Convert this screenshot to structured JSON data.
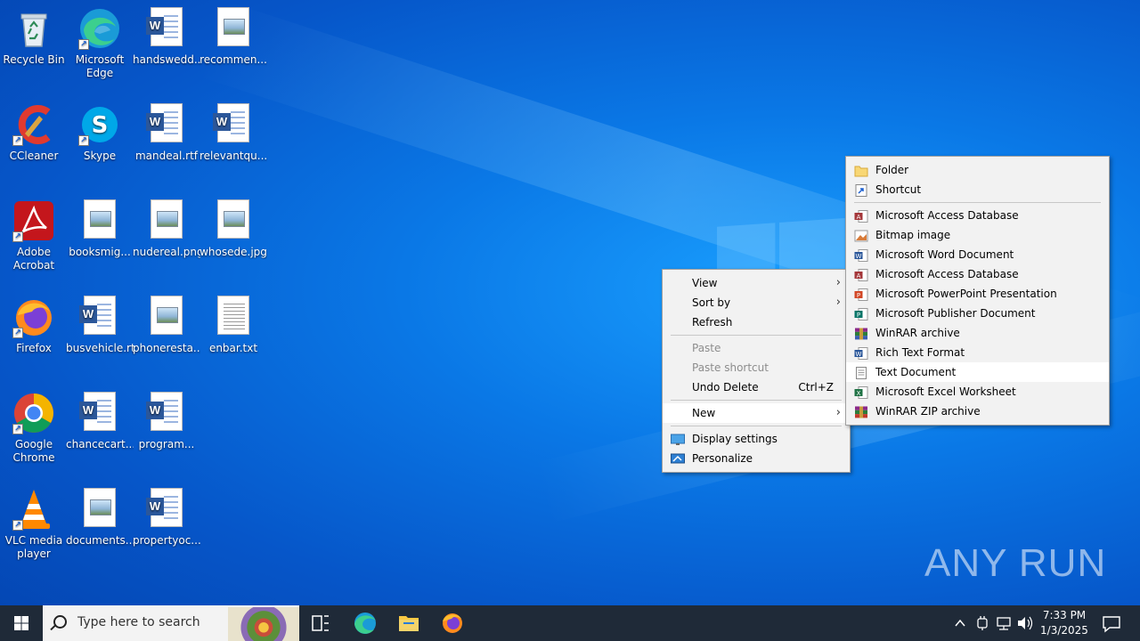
{
  "desktop": {
    "icons": [
      {
        "label": "Recycle Bin"
      },
      {
        "label": "Microsoft Edge"
      },
      {
        "label": "handswedd..."
      },
      {
        "label": "recommen..."
      },
      {
        "label": "CCleaner"
      },
      {
        "label": "Skype"
      },
      {
        "label": "mandeal.rtf"
      },
      {
        "label": "relevantqu..."
      },
      {
        "label": "Adobe Acrobat"
      },
      {
        "label": "booksmig..."
      },
      {
        "label": "nudereal.png"
      },
      {
        "label": "whosede.jpg"
      },
      {
        "label": "Firefox"
      },
      {
        "label": "busvehicle.rtf"
      },
      {
        "label": "phoneresta..."
      },
      {
        "label": "enbar.txt"
      },
      {
        "label": "Google Chrome"
      },
      {
        "label": "chancecart..."
      },
      {
        "label": "program..."
      },
      {
        "label": "VLC media player"
      },
      {
        "label": "documents..."
      },
      {
        "label": "propertyoc..."
      }
    ]
  },
  "context_menu": {
    "view": "View",
    "sort_by": "Sort by",
    "refresh": "Refresh",
    "paste": "Paste",
    "paste_shortcut": "Paste shortcut",
    "undo_delete": "Undo Delete",
    "undo_delete_accel": "Ctrl+Z",
    "new": "New",
    "display_settings": "Display settings",
    "personalize": "Personalize"
  },
  "new_submenu": {
    "items": [
      {
        "label": "Folder",
        "icon": "folder-icon"
      },
      {
        "label": "Shortcut",
        "icon": "shortcut-icon"
      },
      {
        "label": "Microsoft Access Database",
        "icon": "access-icon"
      },
      {
        "label": "Bitmap image",
        "icon": "bitmap-icon"
      },
      {
        "label": "Microsoft Word Document",
        "icon": "word-icon"
      },
      {
        "label": "Microsoft Access Database",
        "icon": "access-icon"
      },
      {
        "label": "Microsoft PowerPoint Presentation",
        "icon": "powerpoint-icon"
      },
      {
        "label": "Microsoft Publisher Document",
        "icon": "publisher-icon"
      },
      {
        "label": "WinRAR archive",
        "icon": "winrar-icon"
      },
      {
        "label": "Rich Text Format",
        "icon": "rtf-icon"
      },
      {
        "label": "Text Document",
        "icon": "text-doc-icon"
      },
      {
        "label": "Microsoft Excel Worksheet",
        "icon": "excel-icon"
      },
      {
        "label": "WinRAR ZIP archive",
        "icon": "winrar-zip-icon"
      }
    ]
  },
  "taskbar": {
    "search_placeholder": "Type here to search",
    "time": "7:33 PM",
    "date": "1/3/2025"
  },
  "watermark": "ANY RUN",
  "colors": {
    "desktop_bg": "#0a78e6",
    "taskbar_bg": "#1f2a38",
    "menu_bg": "#f2f2f2"
  }
}
